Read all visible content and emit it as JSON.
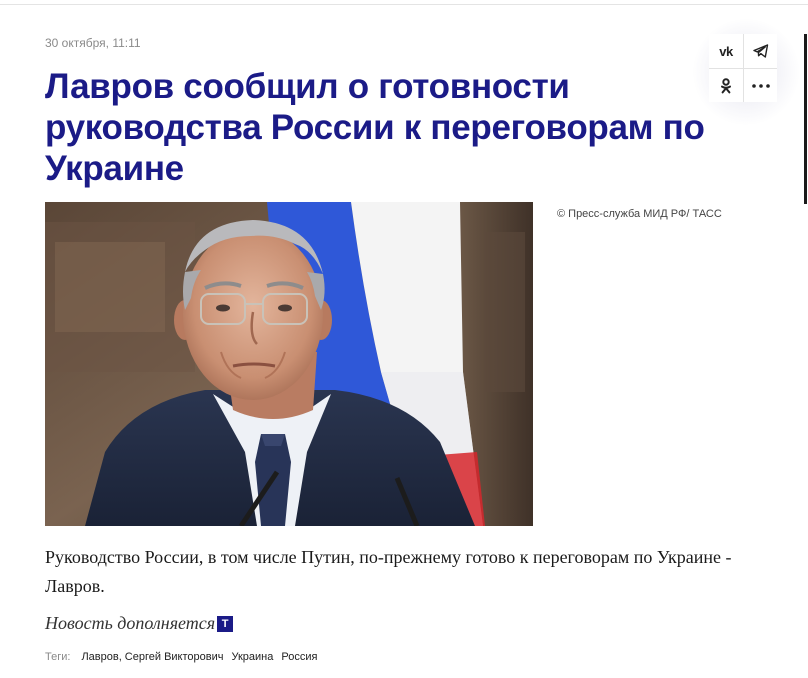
{
  "article": {
    "date": "30 октября, 11:11",
    "title": "Лавров сообщил о готовности руководства России к переговорам по Украине",
    "photo_credit": "© Пресс-служба МИД РФ/ ТАСС",
    "lead": "Руководство России, в том числе Путин, по-прежнему готово к переговорам по Украине - Лавров.",
    "update_note": "Новость дополняется",
    "update_badge": "T"
  },
  "share": {
    "vk_label": "vk",
    "buttons": [
      {
        "name": "vk",
        "icon": "vk-icon"
      },
      {
        "name": "telegram",
        "icon": "telegram-icon"
      },
      {
        "name": "odnoklassniki",
        "icon": "odnoklassniki-icon"
      },
      {
        "name": "more",
        "icon": "more-icon"
      }
    ]
  },
  "tags": {
    "label": "Теги:",
    "items": [
      "Лавров, Сергей Викторович",
      "Украина",
      "Россия"
    ]
  },
  "colors": {
    "title": "#1b1b87",
    "badge": "#1b1b87",
    "flag_blue": "#2f58d8",
    "flag_red": "#d6262b"
  }
}
